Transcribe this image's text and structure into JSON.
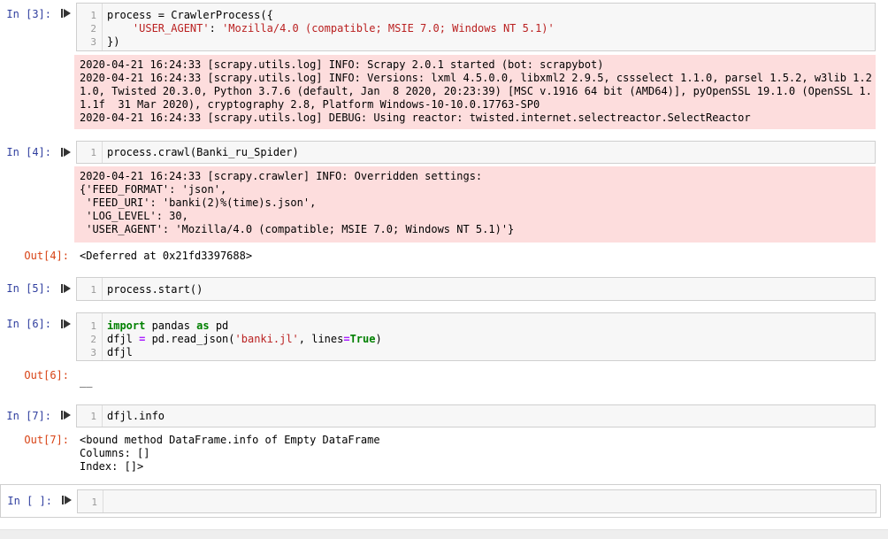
{
  "cells": {
    "c3": {
      "prompt": "In [3]:",
      "lines": [
        "1",
        "2",
        "3"
      ],
      "code_1": "process = CrawlerProcess({",
      "code_2_indent": "    ",
      "code_2_str1": "'USER_AGENT'",
      "code_2_colon": ": ",
      "code_2_str2": "'Mozilla/4.0 (compatible; MSIE 7.0; Windows NT 5.1)'",
      "code_3": "})",
      "stderr": [
        "2020-04-21 16:24:33 [scrapy.utils.log] INFO: Scrapy 2.0.1 started (bot: scrapybot)",
        "2020-04-21 16:24:33 [scrapy.utils.log] INFO: Versions: lxml 4.5.0.0, libxml2 2.9.5, cssselect 1.1.0, parsel 1.5.2, w3lib 1.2",
        "1.0, Twisted 20.3.0, Python 3.7.6 (default, Jan  8 2020, 20:23:39) [MSC v.1916 64 bit (AMD64)], pyOpenSSL 19.1.0 (OpenSSL 1.",
        "1.1f  31 Mar 2020), cryptography 2.8, Platform Windows-10-10.0.17763-SP0",
        "2020-04-21 16:24:33 [scrapy.utils.log] DEBUG: Using reactor: twisted.internet.selectreactor.SelectReactor"
      ]
    },
    "c4": {
      "prompt": "In [4]:",
      "lines": [
        "1"
      ],
      "code_1": "process.crawl(Banki_ru_Spider)",
      "stderr": [
        "2020-04-21 16:24:33 [scrapy.crawler] INFO: Overridden settings:",
        "{'FEED_FORMAT': 'json',",
        " 'FEED_URI': 'banki(2)%(time)s.json',",
        " 'LOG_LEVEL': 30,",
        " 'USER_AGENT': 'Mozilla/4.0 (compatible; MSIE 7.0; Windows NT 5.1)'}"
      ],
      "out_prompt": "Out[4]:",
      "output": [
        "<Deferred at 0x21fd3397688>"
      ]
    },
    "c5": {
      "prompt": "In [5]:",
      "lines": [
        "1"
      ],
      "code_1": "process.start()"
    },
    "c6": {
      "prompt": "In [6]:",
      "lines": [
        "1",
        "2",
        "3"
      ],
      "code_1_kw1": "import",
      "code_1_mid": " pandas ",
      "code_1_kw2": "as",
      "code_1_end": " pd",
      "code_2_a": "dfjl ",
      "code_2_eq": "=",
      "code_2_b": " pd.read_json(",
      "code_2_str": "'banki.jl'",
      "code_2_c": ", lines",
      "code_2_eq2": "=",
      "code_2_true": "True",
      "code_2_d": ")",
      "code_3": "dfjl",
      "out_prompt": "Out[6]:",
      "output": [
        "__"
      ]
    },
    "c7": {
      "prompt": "In [7]:",
      "lines": [
        "1"
      ],
      "code_1": "dfjl.info",
      "out_prompt": "Out[7]:",
      "output": [
        "<bound method DataFrame.info of Empty DataFrame",
        "Columns: []",
        "Index: []>"
      ]
    },
    "c8": {
      "prompt": "In [ ]:",
      "lines": [
        "1"
      ]
    }
  },
  "colors": {
    "in_prompt": "#303f9f",
    "out_prompt": "#d84315",
    "stderr_bg": "#fddddd",
    "editor_bg": "#f7f7f7",
    "keyword": "#008000",
    "string": "#ba2121"
  },
  "icons": {
    "run": "run-cell-icon"
  }
}
